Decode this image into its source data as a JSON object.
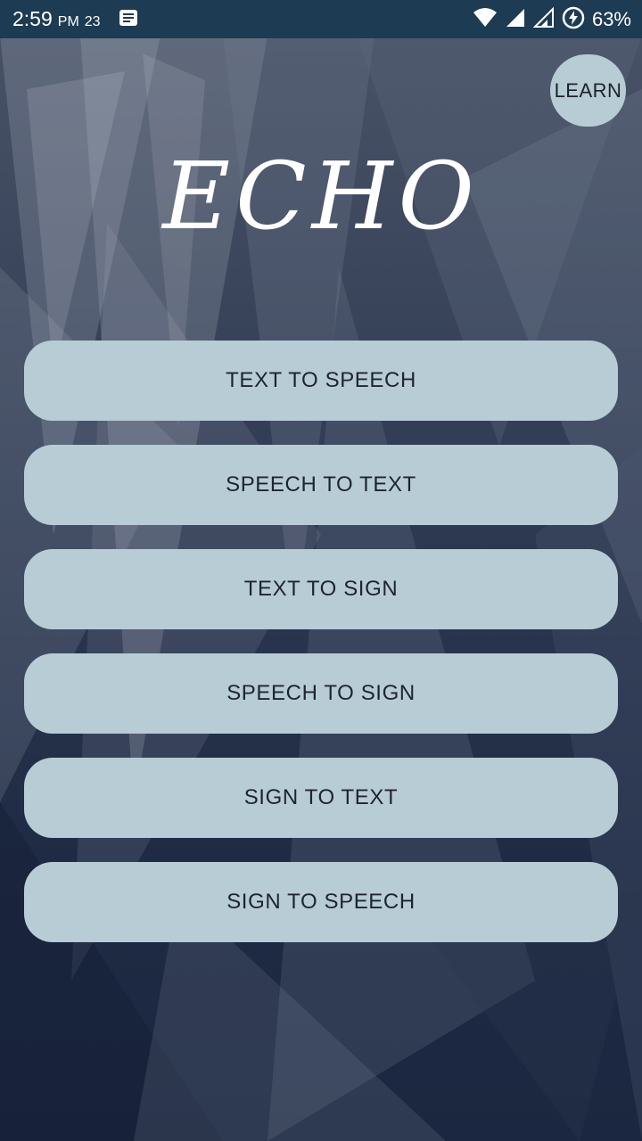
{
  "status_bar": {
    "time": "2:59",
    "ampm": "PM",
    "date": "23",
    "battery": "63%",
    "icons": [
      "notification-icon",
      "wifi-icon",
      "signal-icon",
      "signal-icon-2",
      "battery-charging-icon"
    ]
  },
  "learn_button": {
    "label": "LEARN"
  },
  "app_title": "ECHO",
  "menu": [
    {
      "label": "TEXT TO SPEECH"
    },
    {
      "label": "SPEECH TO TEXT"
    },
    {
      "label": "TEXT TO SIGN"
    },
    {
      "label": "SPEECH TO SIGN"
    },
    {
      "label": "SIGN TO TEXT"
    },
    {
      "label": "SIGN TO SPEECH"
    }
  ],
  "colors": {
    "status_bar_bg": "#1d3b52",
    "button_bg": "#b8ccd6",
    "button_text": "#1e2530",
    "title_color": "#ffffff"
  }
}
